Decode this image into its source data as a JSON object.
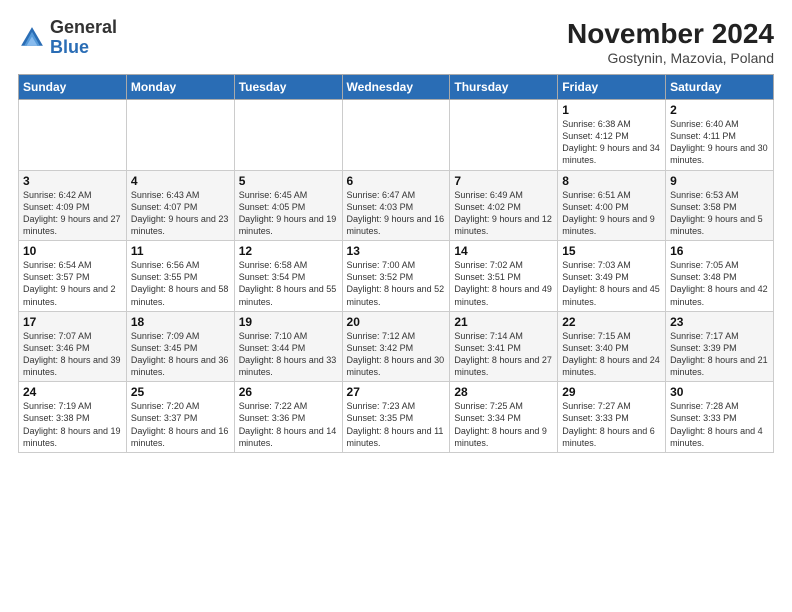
{
  "header": {
    "logo": {
      "line1": "General",
      "line2": "Blue"
    },
    "title": "November 2024",
    "subtitle": "Gostynin, Mazovia, Poland"
  },
  "weekdays": [
    "Sunday",
    "Monday",
    "Tuesday",
    "Wednesday",
    "Thursday",
    "Friday",
    "Saturday"
  ],
  "weeks": [
    [
      {
        "day": "",
        "info": ""
      },
      {
        "day": "",
        "info": ""
      },
      {
        "day": "",
        "info": ""
      },
      {
        "day": "",
        "info": ""
      },
      {
        "day": "",
        "info": ""
      },
      {
        "day": "1",
        "info": "Sunrise: 6:38 AM\nSunset: 4:12 PM\nDaylight: 9 hours and 34 minutes."
      },
      {
        "day": "2",
        "info": "Sunrise: 6:40 AM\nSunset: 4:11 PM\nDaylight: 9 hours and 30 minutes."
      }
    ],
    [
      {
        "day": "3",
        "info": "Sunrise: 6:42 AM\nSunset: 4:09 PM\nDaylight: 9 hours and 27 minutes."
      },
      {
        "day": "4",
        "info": "Sunrise: 6:43 AM\nSunset: 4:07 PM\nDaylight: 9 hours and 23 minutes."
      },
      {
        "day": "5",
        "info": "Sunrise: 6:45 AM\nSunset: 4:05 PM\nDaylight: 9 hours and 19 minutes."
      },
      {
        "day": "6",
        "info": "Sunrise: 6:47 AM\nSunset: 4:03 PM\nDaylight: 9 hours and 16 minutes."
      },
      {
        "day": "7",
        "info": "Sunrise: 6:49 AM\nSunset: 4:02 PM\nDaylight: 9 hours and 12 minutes."
      },
      {
        "day": "8",
        "info": "Sunrise: 6:51 AM\nSunset: 4:00 PM\nDaylight: 9 hours and 9 minutes."
      },
      {
        "day": "9",
        "info": "Sunrise: 6:53 AM\nSunset: 3:58 PM\nDaylight: 9 hours and 5 minutes."
      }
    ],
    [
      {
        "day": "10",
        "info": "Sunrise: 6:54 AM\nSunset: 3:57 PM\nDaylight: 9 hours and 2 minutes."
      },
      {
        "day": "11",
        "info": "Sunrise: 6:56 AM\nSunset: 3:55 PM\nDaylight: 8 hours and 58 minutes."
      },
      {
        "day": "12",
        "info": "Sunrise: 6:58 AM\nSunset: 3:54 PM\nDaylight: 8 hours and 55 minutes."
      },
      {
        "day": "13",
        "info": "Sunrise: 7:00 AM\nSunset: 3:52 PM\nDaylight: 8 hours and 52 minutes."
      },
      {
        "day": "14",
        "info": "Sunrise: 7:02 AM\nSunset: 3:51 PM\nDaylight: 8 hours and 49 minutes."
      },
      {
        "day": "15",
        "info": "Sunrise: 7:03 AM\nSunset: 3:49 PM\nDaylight: 8 hours and 45 minutes."
      },
      {
        "day": "16",
        "info": "Sunrise: 7:05 AM\nSunset: 3:48 PM\nDaylight: 8 hours and 42 minutes."
      }
    ],
    [
      {
        "day": "17",
        "info": "Sunrise: 7:07 AM\nSunset: 3:46 PM\nDaylight: 8 hours and 39 minutes."
      },
      {
        "day": "18",
        "info": "Sunrise: 7:09 AM\nSunset: 3:45 PM\nDaylight: 8 hours and 36 minutes."
      },
      {
        "day": "19",
        "info": "Sunrise: 7:10 AM\nSunset: 3:44 PM\nDaylight: 8 hours and 33 minutes."
      },
      {
        "day": "20",
        "info": "Sunrise: 7:12 AM\nSunset: 3:42 PM\nDaylight: 8 hours and 30 minutes."
      },
      {
        "day": "21",
        "info": "Sunrise: 7:14 AM\nSunset: 3:41 PM\nDaylight: 8 hours and 27 minutes."
      },
      {
        "day": "22",
        "info": "Sunrise: 7:15 AM\nSunset: 3:40 PM\nDaylight: 8 hours and 24 minutes."
      },
      {
        "day": "23",
        "info": "Sunrise: 7:17 AM\nSunset: 3:39 PM\nDaylight: 8 hours and 21 minutes."
      }
    ],
    [
      {
        "day": "24",
        "info": "Sunrise: 7:19 AM\nSunset: 3:38 PM\nDaylight: 8 hours and 19 minutes."
      },
      {
        "day": "25",
        "info": "Sunrise: 7:20 AM\nSunset: 3:37 PM\nDaylight: 8 hours and 16 minutes."
      },
      {
        "day": "26",
        "info": "Sunrise: 7:22 AM\nSunset: 3:36 PM\nDaylight: 8 hours and 14 minutes."
      },
      {
        "day": "27",
        "info": "Sunrise: 7:23 AM\nSunset: 3:35 PM\nDaylight: 8 hours and 11 minutes."
      },
      {
        "day": "28",
        "info": "Sunrise: 7:25 AM\nSunset: 3:34 PM\nDaylight: 8 hours and 9 minutes."
      },
      {
        "day": "29",
        "info": "Sunrise: 7:27 AM\nSunset: 3:33 PM\nDaylight: 8 hours and 6 minutes."
      },
      {
        "day": "30",
        "info": "Sunrise: 7:28 AM\nSunset: 3:33 PM\nDaylight: 8 hours and 4 minutes."
      }
    ]
  ]
}
